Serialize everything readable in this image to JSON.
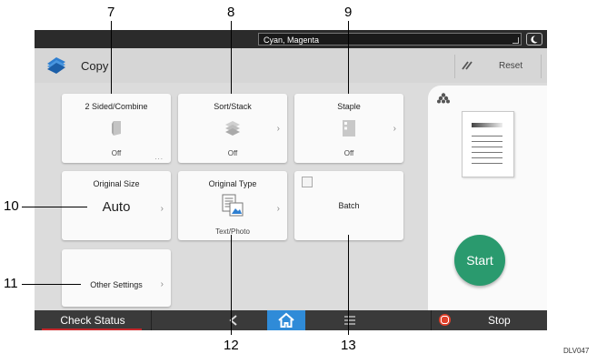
{
  "status": {
    "mode_text": "Cyan, Magenta"
  },
  "header": {
    "title": "Copy",
    "reset_label": "Reset"
  },
  "tiles": {
    "two_sided": {
      "label": "2 Sided/Combine",
      "value": "Off",
      "more": "..."
    },
    "sort_stack": {
      "label": "Sort/Stack",
      "value": "Off"
    },
    "staple": {
      "label": "Staple",
      "value": "Off"
    },
    "original_size": {
      "label": "Original Size",
      "value": "Auto"
    },
    "original_type": {
      "label": "Original Type",
      "value": "Text/Photo"
    },
    "batch": {
      "label": "Batch"
    },
    "other_settings": {
      "label": "Other Settings"
    }
  },
  "chevron": "›",
  "start_label": "Start",
  "bottom": {
    "check_status": "Check Status",
    "stop": "Stop"
  },
  "callouts": {
    "c7": "7",
    "c8": "8",
    "c9": "9",
    "c10": "10",
    "c11": "11",
    "c12": "12",
    "c13": "13"
  },
  "doc_code": "DLV047",
  "colors": {
    "accent_green": "#2a9a6e",
    "home_blue": "#2f8bd8",
    "stop_red": "#e0412b",
    "copy_icon_blue": "#2f7fd0"
  }
}
